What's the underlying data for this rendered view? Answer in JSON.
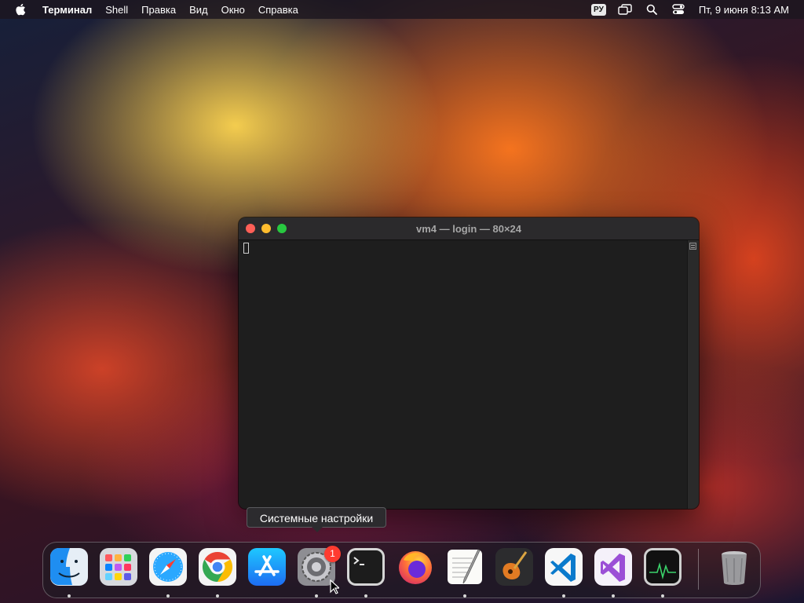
{
  "menubar": {
    "app_name": "Терминал",
    "menus": [
      "Shell",
      "Правка",
      "Вид",
      "Окно",
      "Справка"
    ],
    "input_language": "РУ",
    "datetime": "Пт, 9 июня  8:13 AM",
    "icons": [
      "apple-icon",
      "screen-mirroring-icon",
      "spotlight-search-icon",
      "control-center-icon"
    ]
  },
  "terminal_window": {
    "title": "vm4 — login — 80×24",
    "content": ""
  },
  "tooltip": {
    "text": "Системные настройки"
  },
  "dock": {
    "items": [
      {
        "icon": "finder-icon",
        "running": true
      },
      {
        "icon": "launchpad-icon",
        "running": false
      },
      {
        "icon": "safari-icon",
        "running": true
      },
      {
        "icon": "chrome-icon",
        "running": true
      },
      {
        "icon": "app-store-icon",
        "running": false
      },
      {
        "icon": "system-settings-icon",
        "running": true,
        "badge": "1"
      },
      {
        "icon": "terminal-icon",
        "running": true
      },
      {
        "icon": "firefox-icon",
        "running": false
      },
      {
        "icon": "textedit-icon",
        "running": true
      },
      {
        "icon": "garageband-icon",
        "running": false
      },
      {
        "icon": "vscode-icon",
        "running": true
      },
      {
        "icon": "visual-studio-icon",
        "running": true
      },
      {
        "icon": "activity-monitor-icon",
        "running": true
      },
      {
        "icon": "trash-icon",
        "running": false
      }
    ]
  },
  "colors": {
    "close": "#ff5f57",
    "minimize": "#febc2e",
    "maximize": "#28c840",
    "badge": "#ff3b30"
  }
}
